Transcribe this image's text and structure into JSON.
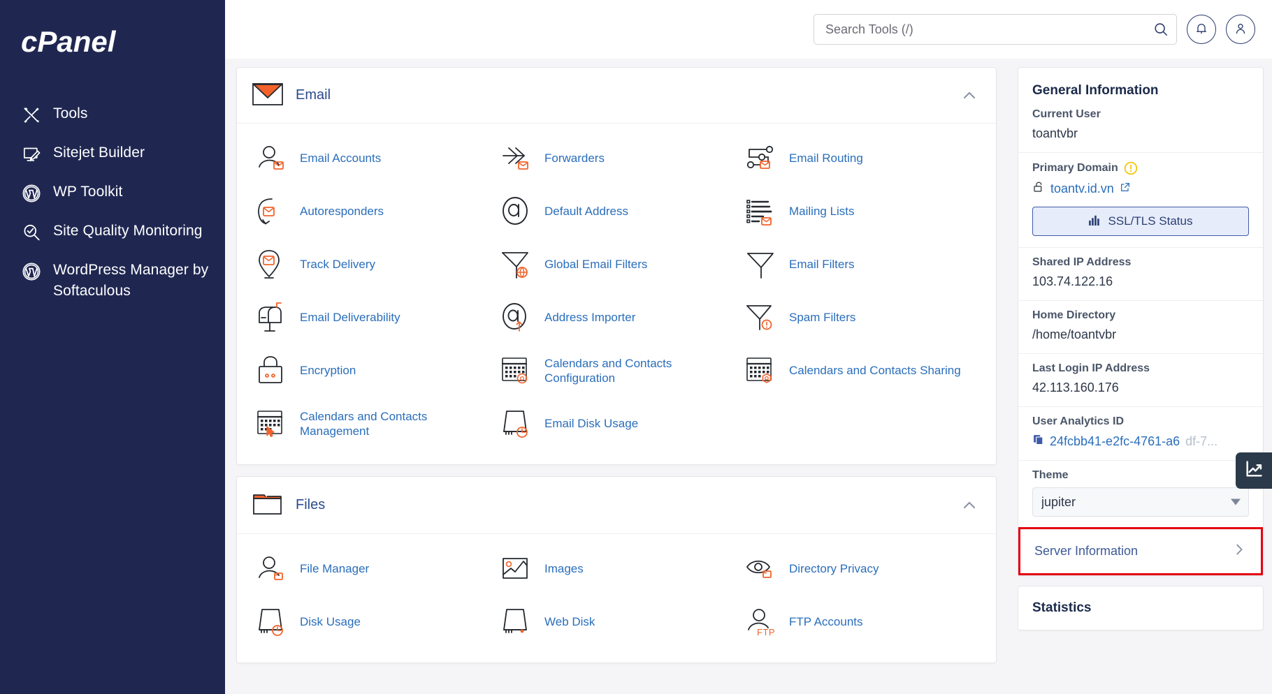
{
  "brand": {
    "name": "cPanel"
  },
  "sidebar": {
    "items": [
      {
        "label": "Tools",
        "icon": "tools-icon"
      },
      {
        "label": "Sitejet Builder",
        "icon": "monitor-pencil-icon"
      },
      {
        "label": "WP Toolkit",
        "icon": "wordpress-icon"
      },
      {
        "label": "Site Quality Monitoring",
        "icon": "magnifier-check-icon"
      },
      {
        "label": "WordPress Manager by Softaculous",
        "icon": "wordpress-icon"
      }
    ]
  },
  "topbar": {
    "search": {
      "placeholder": "Search Tools (/)",
      "value": ""
    },
    "search_icon": "search-icon",
    "notifications_icon": "bell-icon",
    "account_icon": "user-icon"
  },
  "sections": [
    {
      "id": "email",
      "title": "Email",
      "icon": "envelope-icon",
      "collapse_icon": "chevron-up-icon",
      "items": [
        {
          "label": "Email Accounts",
          "icon": "user-envelope-icon"
        },
        {
          "label": "Forwarders",
          "icon": "arrows-forward-envelope-icon"
        },
        {
          "label": "Email Routing",
          "icon": "routing-nodes-envelope-icon"
        },
        {
          "label": "Autoresponders",
          "icon": "loop-envelope-icon"
        },
        {
          "label": "Default Address",
          "icon": "at-sign-icon"
        },
        {
          "label": "Mailing Lists",
          "icon": "list-envelope-icon"
        },
        {
          "label": "Track Delivery",
          "icon": "pin-envelope-icon"
        },
        {
          "label": "Global Email Filters",
          "icon": "funnel-globe-icon"
        },
        {
          "label": "Email Filters",
          "icon": "funnel-icon"
        },
        {
          "label": "Email Deliverability",
          "icon": "mailbox-icon"
        },
        {
          "label": "Address Importer",
          "icon": "at-sign-arrow-up-icon"
        },
        {
          "label": "Spam Filters",
          "icon": "funnel-alert-icon"
        },
        {
          "label": "Encryption",
          "icon": "padlock-icon"
        },
        {
          "label": "Calendars and Contacts Configuration",
          "icon": "calendar-at-icon"
        },
        {
          "label": "Calendars and Contacts Sharing",
          "icon": "calendar-share-icon"
        },
        {
          "label": "Calendars and Contacts Management",
          "icon": "calendar-cursor-icon"
        },
        {
          "label": "Email Disk Usage",
          "icon": "disk-clock-icon"
        }
      ]
    },
    {
      "id": "files",
      "title": "Files",
      "icon": "folder-icon",
      "collapse_icon": "chevron-up-icon",
      "items": [
        {
          "label": "File Manager",
          "icon": "user-folder-icon"
        },
        {
          "label": "Images",
          "icon": "image-icon"
        },
        {
          "label": "Directory Privacy",
          "icon": "eye-folder-icon"
        },
        {
          "label": "Disk Usage",
          "icon": "disk-clock-icon"
        },
        {
          "label": "Web Disk",
          "icon": "disk-icon"
        },
        {
          "label": "FTP Accounts",
          "icon": "user-ftp-icon"
        }
      ]
    }
  ],
  "general_information": {
    "title": "General Information",
    "current_user": {
      "label": "Current User",
      "value": "toantvbr"
    },
    "primary_domain": {
      "label": "Primary Domain",
      "warning_icon": "warning-circle-icon",
      "lock_icon": "unlocked-padlock-icon",
      "value": "toantv.id.vn",
      "external_icon": "external-link-icon"
    },
    "ssl_button": {
      "label": "SSL/TLS Status",
      "icon": "bar-chart-icon"
    },
    "shared_ip": {
      "label": "Shared IP Address",
      "value": "103.74.122.16"
    },
    "home_directory": {
      "label": "Home Directory",
      "value": "/home/toantvbr"
    },
    "last_login_ip": {
      "label": "Last Login IP Address",
      "value": "42.113.160.176"
    },
    "user_analytics_id": {
      "label": "User Analytics ID",
      "copy_icon": "copy-icon",
      "value": "24fcbb41-e2fc-4761-a6",
      "value_tail": "df-7..."
    },
    "theme": {
      "label": "Theme",
      "selected": "jupiter",
      "options": [
        "jupiter"
      ],
      "caret_icon": "chevron-down-icon"
    },
    "server_information": {
      "label": "Server Information",
      "chevron_icon": "chevron-right-icon",
      "highlight_color": "#e3000f"
    }
  },
  "statistics": {
    "title": "Statistics"
  },
  "analytics_tab": {
    "icon": "line-chart-icon"
  },
  "colors": {
    "sidebar_bg": "#1f2751",
    "accent_orange": "#f2622a",
    "link_blue": "#2a6ebb",
    "page_bg": "#f5f5f7",
    "highlight_red": "#e3000f"
  }
}
